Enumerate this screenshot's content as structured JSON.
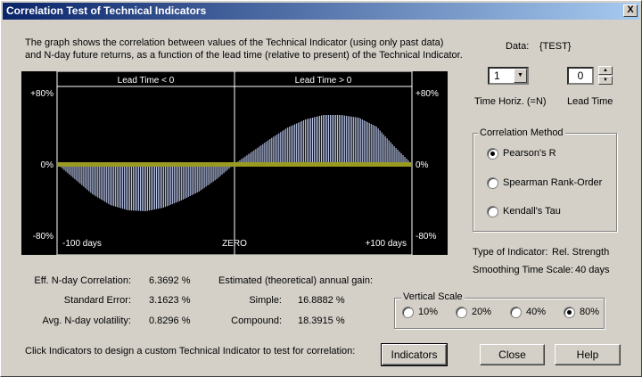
{
  "window": {
    "title": "Correlation Test of Technical Indicators",
    "close_glyph": "X"
  },
  "description": {
    "line1": "The graph shows the correlation between values of the Technical Indicator (using only past data)",
    "line2": "and N-day future returns, as a function of the lead time (relative to present) of the Technical Indicator."
  },
  "data_source": {
    "label": "Data:",
    "value": "{TEST}"
  },
  "time_horizon": {
    "value": "1",
    "label": "Time Horiz. (=N)"
  },
  "lead_time": {
    "value": "0",
    "label": "Lead Time"
  },
  "correlation_method": {
    "title": "Correlation Method",
    "options": [
      "Pearson's R",
      "Spearman Rank-Order",
      "Kendall's Tau"
    ],
    "selected": "Pearson's R"
  },
  "indicator": {
    "type_label": "Type of Indicator:",
    "type_value": "Rel. Strength",
    "smoothing_label": "Smoothing Time Scale:",
    "smoothing_value": "40 days"
  },
  "vertical_scale": {
    "title": "Vertical Scale",
    "options": [
      "10%",
      "20%",
      "40%",
      "80%"
    ],
    "selected": "80%"
  },
  "stats": {
    "eff_label": "Eff. N-day Correlation:",
    "eff_value": "6.3692 %",
    "stderr_label": "Standard Error:",
    "stderr_value": "3.1623 %",
    "vol_label": "Avg. N-day volatility:",
    "vol_value": "0.8296 %",
    "gain_label": "Estimated (theoretical) annual gain:",
    "simple_label": "Simple:",
    "simple_value": "16.8882 %",
    "compound_label": "Compound:",
    "compound_value": "18.3915 %"
  },
  "footer": {
    "hint": "Click Indicators to design a custom Technical Indicator to test for correlation:",
    "indicators_button": "Indicators",
    "close_button": "Close",
    "help_button": "Help"
  },
  "colors": {
    "chart_bg": "#000000",
    "curve": "#b8c4e8",
    "zero_band": "#9a9a22",
    "titlebar_start": "#0a246a",
    "titlebar_end": "#a6caf0"
  },
  "chart_data": {
    "type": "area",
    "header_left": "Lead Time < 0",
    "header_right": "Lead Time > 0",
    "y_ticks_left": [
      "+80%",
      "0%",
      "-80%"
    ],
    "y_ticks_right": [
      "+80%",
      "0%",
      "-80%"
    ],
    "x_labels": [
      "-100 days",
      "ZERO",
      "+100 days"
    ],
    "xlim": [
      -100,
      100
    ],
    "ylim": [
      -80,
      80
    ],
    "x": [
      -100,
      -90,
      -80,
      -70,
      -60,
      -50,
      -40,
      -30,
      -20,
      -10,
      0,
      10,
      20,
      30,
      40,
      50,
      60,
      70,
      80,
      90,
      100
    ],
    "y": [
      0,
      -17,
      -34,
      -46,
      -52,
      -53,
      -49,
      -41,
      -31,
      -17,
      0,
      14,
      28,
      41,
      50,
      55,
      55,
      52,
      42,
      20,
      0
    ]
  }
}
